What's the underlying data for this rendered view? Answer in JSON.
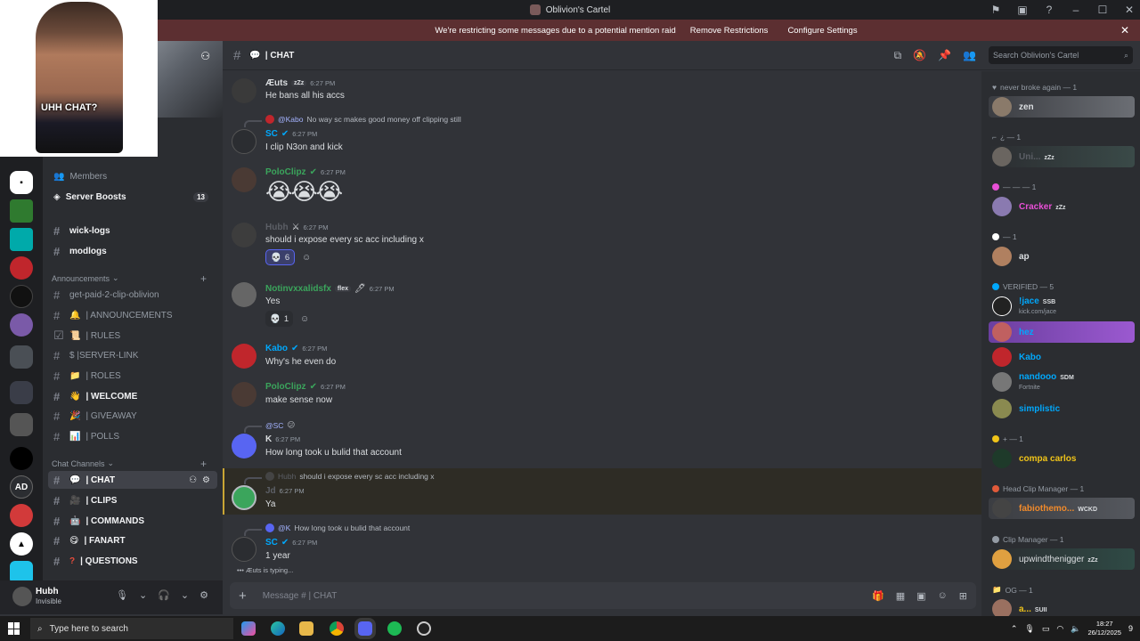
{
  "window": {
    "title": "Oblivion's Cartel",
    "controls": [
      "⚑",
      "▣",
      "?",
      "–",
      "☐",
      "✕"
    ]
  },
  "notice": {
    "text": "We're restricting some messages due to a potential mention raid",
    "remove_label": "Remove Restrictions",
    "configure_label": "Configure Settings"
  },
  "webcam": {
    "caption": "UHH CHAT?"
  },
  "sidebar": {
    "top_rows": [
      {
        "label": "Members"
      },
      {
        "label": "Server Boosts",
        "badge": "13"
      }
    ],
    "pinned": [
      {
        "label": "wick-logs"
      },
      {
        "label": "modlogs"
      }
    ],
    "announcements_category": "Announcements",
    "announcements": [
      {
        "label": "get-paid-2-clip-oblivion",
        "bold": false
      },
      {
        "label": "| ANNOUNCEMENTS",
        "bold": false
      },
      {
        "label": "| RULES",
        "bold": false
      },
      {
        "label": "$ |SERVER-LINK",
        "bold": false
      },
      {
        "label": "| ROLES",
        "bold": false
      },
      {
        "label": "| WELCOME",
        "bold": true
      },
      {
        "label": "| GIVEAWAY",
        "bold": false
      },
      {
        "label": "| POLLS",
        "bold": false
      }
    ],
    "chat_category": "Chat Channels",
    "chat": [
      {
        "label": "| CHAT",
        "active": true
      },
      {
        "label": "| CLIPS"
      },
      {
        "label": "| COMMANDS"
      },
      {
        "label": "| FANART"
      },
      {
        "label": "| QUESTIONS"
      }
    ]
  },
  "user": {
    "name": "Hubh",
    "status": "Invisible"
  },
  "channel": {
    "name": "| CHAT",
    "search_placeholder": "Search Oblivion's Cartel",
    "composer_placeholder": "Message #   | CHAT"
  },
  "messages": [
    {
      "author": "Æuts",
      "tag": "zZz",
      "time": "6:27 PM",
      "text": "He bans all his accs",
      "color": "#dbdee1"
    },
    {
      "reply_to": "@Kabo",
      "reply_text": "No way sc makes good money off clipping still",
      "author": "SC",
      "time": "6:27 PM",
      "text": "I clip N3on and kick",
      "color": "#00a8fc"
    },
    {
      "author": "PoloClipz",
      "time": "6:27 PM",
      "emojis": "😭😭😭",
      "color": "#3ba55c"
    },
    {
      "author": "Hubh",
      "time": "6:27 PM",
      "text": "should i expose every sc acc including x",
      "color": "#5c5f66",
      "reaction_count": "6"
    },
    {
      "author": "Notinvxxalidsfx",
      "tag": "flex",
      "time": "6:27 PM",
      "text": "Yes",
      "color": "#3ba55c",
      "reaction_count": "1"
    },
    {
      "author": "Kabo",
      "time": "6:27 PM",
      "text": "Why's he even do",
      "color": "#00a8fc"
    },
    {
      "author": "PoloClipz",
      "time": "6:27 PM",
      "text": "make sense now",
      "color": "#3ba55c"
    },
    {
      "reply_to": "@SC",
      "reply_text": "",
      "author": "K",
      "time": "6:27 PM",
      "text": "How long took u bulid that account",
      "color": "#dbdee1"
    },
    {
      "reply_to": "Hubh",
      "reply_text": "should i expose every sc acc including x",
      "author": "Jd",
      "time": "6:27 PM",
      "text": "Ya",
      "color": "#5c5f66"
    },
    {
      "reply_to": "@K",
      "reply_text": "How long took u bulid that account",
      "author": "SC",
      "time": "6:27 PM",
      "text": "1 year",
      "color": "#00a8fc"
    }
  ],
  "typing": "Æuts is typing...",
  "members": {
    "roles": [
      {
        "label": "never broke again — 1"
      },
      {
        "label": "¿ — 1"
      },
      {
        "label": "— — — 1"
      },
      {
        "label": "— 1"
      },
      {
        "label": "VERIFIED — 5"
      },
      {
        "label": "+ — 1"
      },
      {
        "label": "Head Clip Manager — 1"
      },
      {
        "label": "Clip Manager — 1"
      },
      {
        "label": "OG — 1"
      }
    ],
    "list": [
      {
        "name": "zen",
        "color": "#dbdee1"
      },
      {
        "name": "Uni...",
        "tag": "zZz",
        "color": "#5c5f66"
      },
      {
        "name": "Cracker",
        "tag": "zZz",
        "color": "#e84fd6"
      },
      {
        "name": "ap",
        "color": "#dbdee1"
      },
      {
        "name": "!jace",
        "tag": "SSB",
        "sub": "kick.com/jace",
        "color": "#00a8fc"
      },
      {
        "name": "hez",
        "color": "#00a8fc"
      },
      {
        "name": "Kabo",
        "color": "#00a8fc"
      },
      {
        "name": "nandooo",
        "tag": "SDM",
        "sub": "Fortnite",
        "color": "#00a8fc"
      },
      {
        "name": "simplistic",
        "color": "#00a8fc"
      },
      {
        "name": "compa carlos",
        "color": "#f0c419"
      },
      {
        "name": "fabiothemo...",
        "tag": "WCKD",
        "color": "#f08a2b"
      },
      {
        "name": "upwindthenigger",
        "tag": "zZz",
        "color": "#dbdee1"
      },
      {
        "name": "a...",
        "tag": "SUII",
        "color": "#f0c419"
      }
    ]
  },
  "taskbar": {
    "search_placeholder": "Type here to search",
    "time": "18:27",
    "date": "26/12/2025",
    "notif": "9"
  }
}
